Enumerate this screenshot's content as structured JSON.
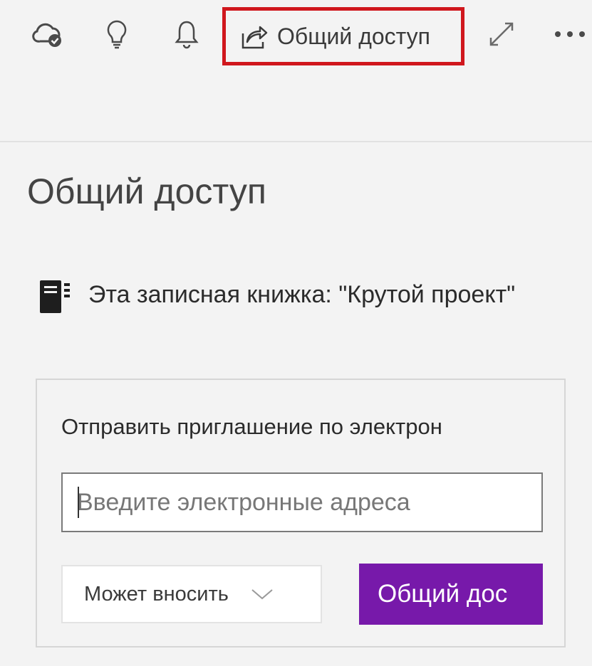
{
  "toolbar": {
    "icons": [
      "cloud-sync-icon",
      "lightbulb-icon",
      "bell-icon",
      "share-icon",
      "expand-icon",
      "more-icon"
    ],
    "share_label": "Общий доступ",
    "highlight_color": "#d0171d"
  },
  "panel": {
    "title": "Общий доступ",
    "notebook_text": "Эта записная книжка: \"Крутой проект\"",
    "invite": {
      "heading": "Отправить приглашение по электрон",
      "email_placeholder": "Введите электронные адреса",
      "permission_selected": "Может вносить",
      "submit_label": "Общий дос"
    }
  },
  "colors": {
    "accent": "#7719aa",
    "background": "#f3f3f3"
  }
}
